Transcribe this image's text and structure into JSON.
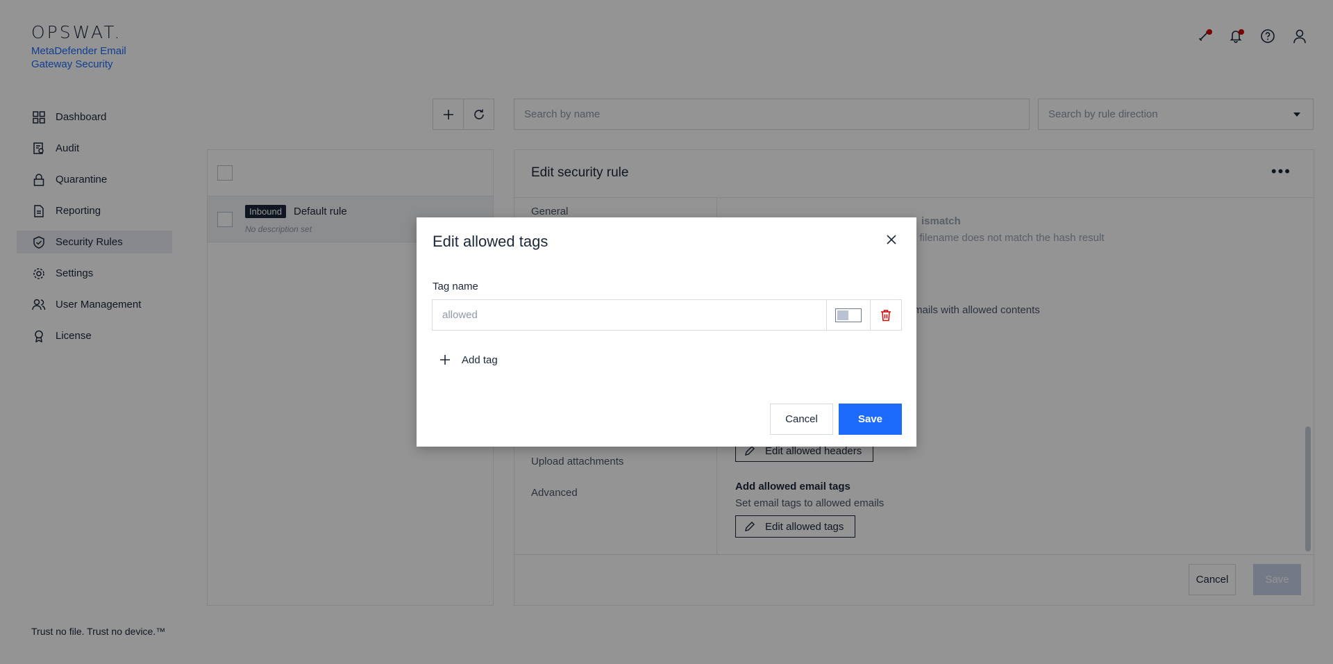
{
  "header": {
    "logo": "OPSWAT.",
    "product_name": "MetaDefender Email Gateway Security",
    "icons": [
      "integrations-icon",
      "bell-icon",
      "help-icon",
      "user-icon"
    ]
  },
  "sidebar": {
    "items": [
      {
        "label": "Dashboard",
        "icon": "dashboard-icon"
      },
      {
        "label": "Audit",
        "icon": "audit-icon"
      },
      {
        "label": "Quarantine",
        "icon": "lock-icon"
      },
      {
        "label": "Reporting",
        "icon": "report-icon"
      },
      {
        "label": "Security Rules",
        "icon": "shield-check-icon",
        "active": true
      },
      {
        "label": "Settings",
        "icon": "gear-icon"
      },
      {
        "label": "User Management",
        "icon": "users-icon"
      },
      {
        "label": "License",
        "icon": "award-icon"
      }
    ],
    "footer": "Trust no file. Trust no device.™"
  },
  "toolbar": {
    "search_placeholder": "Search by name",
    "direction_placeholder": "Search by rule direction"
  },
  "rules_list": {
    "rows": [
      {
        "badge": "Inbound",
        "name": "Default rule",
        "description": "No description set"
      }
    ]
  },
  "detail": {
    "title": "Edit security rule",
    "tabs": {
      "general": "General",
      "upload_attachments": "Upload attachments",
      "advanced": "Advanced"
    },
    "mismatch_title": "ismatch",
    "mismatch_sub": "e filename does not match the hash result",
    "allowed_contents": "mails with allowed contents",
    "edit_headers": "Edit allowed headers",
    "email_tags_title": "Add allowed email tags",
    "email_tags_sub": "Set email tags to allowed emails",
    "edit_tags": "Edit allowed tags",
    "cancel": "Cancel",
    "save": "Save"
  },
  "modal": {
    "title": "Edit allowed tags",
    "field_label": "Tag name",
    "tag_value": "allowed",
    "add_tag": "Add tag",
    "cancel": "Cancel",
    "save": "Save"
  },
  "colors": {
    "accent": "#1d6bfc",
    "text": "#1b273a",
    "danger": "#d00300"
  }
}
